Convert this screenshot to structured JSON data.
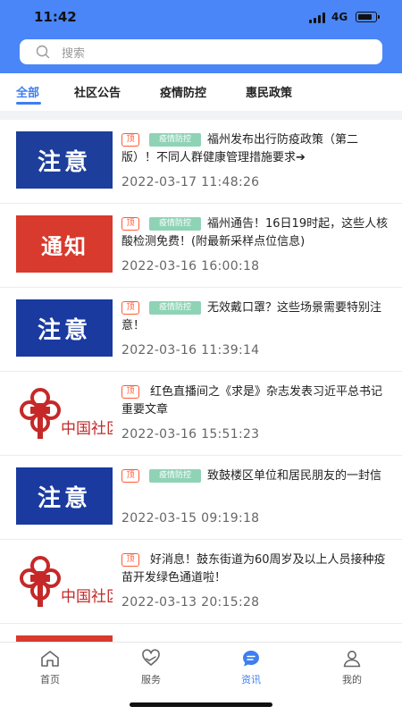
{
  "status": {
    "time": "11:42",
    "network": "4G"
  },
  "search": {
    "placeholder": "搜索"
  },
  "tabs": [
    {
      "label": "全部",
      "active": true
    },
    {
      "label": "社区公告",
      "active": false
    },
    {
      "label": "疫情防控",
      "active": false
    },
    {
      "label": "惠民政策",
      "active": false
    }
  ],
  "articles": [
    {
      "thumb_text": "注意",
      "pinned_label": "顶",
      "category": "疫情防控",
      "title": "福州发布出行防疫政策（第二版）！不同人群健康管理措施要求➔",
      "date": "2022-03-17 11:48:26"
    },
    {
      "thumb_text": "通知",
      "pinned_label": "顶",
      "category": "疫情防控",
      "title": "福州通告！16日19时起，这些人核酸检测免费！(附最新采样点位信息)",
      "date": "2022-03-16 16:00:18"
    },
    {
      "thumb_text": "注意",
      "pinned_label": "顶",
      "category": "疫情防控",
      "title": "无效戴口罩？这些场景需要特别注意！",
      "date": "2022-03-16 11:39:14"
    },
    {
      "thumb_text": "中国社区",
      "pinned_label": "顶",
      "category": "",
      "title": "红色直播间之《求是》杂志发表习近平总书记重要文章",
      "date": "2022-03-16 15:51:23"
    },
    {
      "thumb_text": "注意",
      "pinned_label": "顶",
      "category": "疫情防控",
      "title": "致鼓楼区单位和居民朋友的一封信",
      "date": "2022-03-15 09:19:18"
    },
    {
      "thumb_text": "中国社区",
      "pinned_label": "顶",
      "category": "",
      "title": "好消息！鼓东街道为60周岁及以上人员接种疫苗开发绿色通道啦！",
      "date": "2022-03-13 20:15:28"
    }
  ],
  "nav": [
    {
      "label": "首页",
      "icon": "home-icon",
      "active": false
    },
    {
      "label": "服务",
      "icon": "heart-hand-icon",
      "active": false
    },
    {
      "label": "资讯",
      "icon": "chat-icon",
      "active": true
    },
    {
      "label": "我的",
      "icon": "user-icon",
      "active": false
    }
  ],
  "colors": {
    "header": "#4a86f7",
    "accent": "#3d7ef2",
    "tag_green": "#8fd3b6",
    "tag_top": "#ff5a36"
  }
}
